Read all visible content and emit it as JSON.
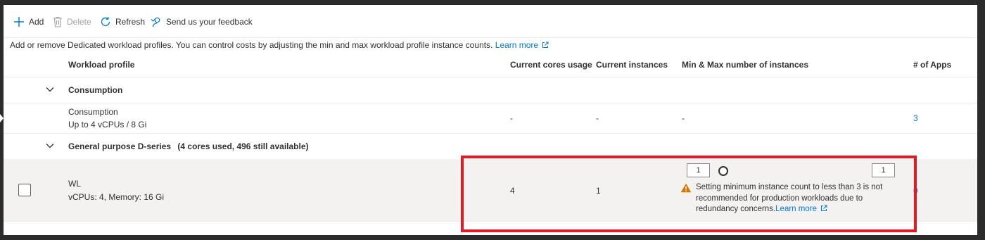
{
  "toolbar": {
    "add_label": "Add",
    "delete_label": "Delete",
    "refresh_label": "Refresh",
    "feedback_label": "Send us your feedback"
  },
  "description": {
    "text": "Add or remove Dedicated workload profiles. You can control costs by adjusting the min and max workload profile instance counts.",
    "link_label": "Learn more"
  },
  "table": {
    "headers": {
      "profile": "Workload profile",
      "cores": "Current cores usage",
      "instances": "Current instances",
      "minmax": "Min & Max number of instances",
      "apps": "# of Apps"
    },
    "groups": [
      {
        "title": "Consumption",
        "rows": [
          {
            "name": "Consumption",
            "spec": "Up to 4 vCPUs / 8 Gi",
            "cores": "-",
            "instances": "-",
            "minmax": "-",
            "apps": "3"
          }
        ]
      },
      {
        "title": "General purpose D-series",
        "subtitle": "(4 cores used, 496 still available)",
        "rows": [
          {
            "name": "WL",
            "spec": "vCPUs: 4, Memory: 16 Gi",
            "cores": "4",
            "instances": "1",
            "min_value": "1",
            "max_value": "1",
            "warning": "Setting minimum instance count to less than 3 is not recommended for production workloads due to redundancy concerns.",
            "warning_link": "Learn more",
            "apps": "0"
          }
        ]
      }
    ]
  },
  "colors": {
    "accent": "#0078d4",
    "warning": "#d47500",
    "highlight": "#e01b24"
  }
}
